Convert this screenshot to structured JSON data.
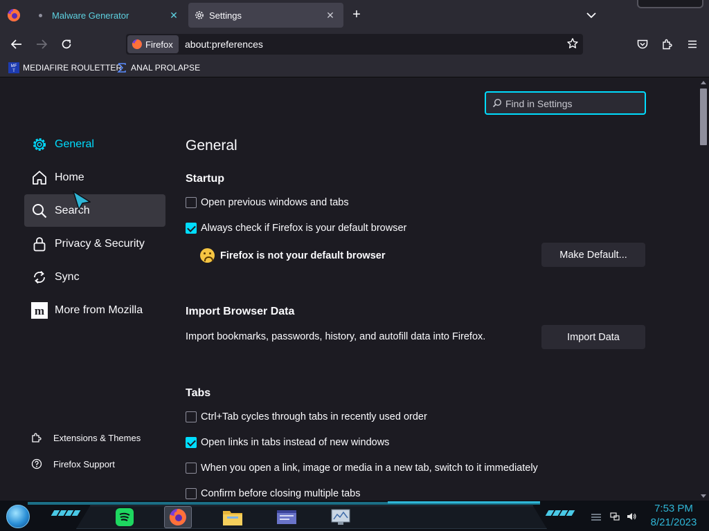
{
  "tabs": [
    {
      "title": "Malware Generator",
      "active": false
    },
    {
      "title": "Settings",
      "active": true
    }
  ],
  "navbar": {
    "identity_label": "Firefox",
    "url": "about:preferences"
  },
  "bookmarks": [
    {
      "label": "MEDIAFIRE ROULETTER",
      "icon": "mft-icon"
    },
    {
      "label": "ANAL PROLAPSE",
      "icon": "sigma-icon"
    }
  ],
  "search": {
    "placeholder": "Find in Settings"
  },
  "categories": [
    {
      "label": "General",
      "icon": "gear-icon",
      "selected": true
    },
    {
      "label": "Home",
      "icon": "home-icon"
    },
    {
      "label": "Search",
      "icon": "search-icon"
    },
    {
      "label": "Privacy & Security",
      "icon": "lock-icon"
    },
    {
      "label": "Sync",
      "icon": "sync-icon"
    },
    {
      "label": "More from Mozilla",
      "icon": "mozilla-icon"
    }
  ],
  "footer": [
    {
      "label": "Extensions & Themes",
      "icon": "puzzle-icon"
    },
    {
      "label": "Firefox Support",
      "icon": "help-icon"
    }
  ],
  "pane": {
    "title": "General",
    "startup": {
      "heading": "Startup",
      "restore_session": {
        "label": "Open previous windows and tabs",
        "checked": false
      },
      "check_default": {
        "label": "Always check if Firefox is your default browser",
        "checked": true
      },
      "not_default": "Firefox is not your default browser",
      "make_default_button": "Make Default..."
    },
    "import": {
      "heading": "Import Browser Data",
      "description": "Import bookmarks, passwords, history, and autofill data into Firefox.",
      "button": "Import Data"
    },
    "tabs_section": {
      "heading": "Tabs",
      "options": [
        {
          "label": "Ctrl+Tab cycles through tabs in recently used order",
          "checked": false
        },
        {
          "label": "Open links in tabs instead of new windows",
          "checked": true
        },
        {
          "label": "When you open a link, image or media in a new tab, switch to it immediately",
          "checked": false
        },
        {
          "label": "Confirm before closing multiple tabs",
          "checked": false
        }
      ]
    }
  },
  "taskbar": {
    "apps": [
      "spotify-icon",
      "firefox-icon",
      "file-explorer-icon",
      "app-window-icon",
      "monitor-icon"
    ],
    "time": "7:53 PM",
    "date": "8/21/2023"
  },
  "colors": {
    "accent": "#00ddff",
    "background": "#1c1b22",
    "toolbar": "#2b2a33"
  }
}
